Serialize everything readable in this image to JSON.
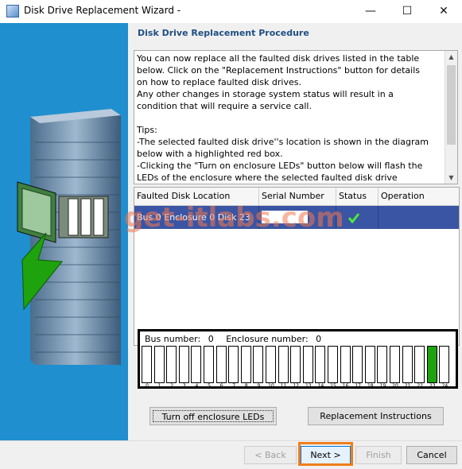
{
  "window": {
    "title": "Disk Drive Replacement Wizard -",
    "minimize_glyph": "—",
    "maximize_glyph": "☐",
    "close_glyph": "✕"
  },
  "header": {
    "title": "Disk Drive Replacement Procedure"
  },
  "instructions": {
    "lines": [
      "You can now replace all the faulted disk drives listed in the table",
      "below. Click on the \"Replacement Instructions\" button for details",
      "on how to replace faulted disk drives.",
      "Any other changes in storage system status will result in a",
      "condition that will require a service call.",
      "",
      "Tips:",
      "-The selected faulted disk drive''s location is shown in the diagram",
      "below with a highlighted red box.",
      "-Clicking the \"Turn on enclosure LEDs\" button below will flash the",
      "LEDs of the enclosure where the selected faulted disk drive"
    ]
  },
  "table": {
    "columns": [
      "Faulted Disk Location",
      "Serial Number",
      "Status",
      "Operation"
    ],
    "rows": [
      {
        "location": "Bus 0 Enclosure 0 Disk 23",
        "serial": "",
        "status_icon": "checkmark-icon",
        "operation": ""
      }
    ]
  },
  "diagram": {
    "bus_label": "Bus number:",
    "bus_number": "0",
    "enclosure_label": "Enclosure number:",
    "enclosure_number": "0",
    "slot_count": 25,
    "highlighted_slot": 23,
    "highlight_color": "#1ea20d"
  },
  "buttons": {
    "turn_off_leds": "Turn off enclosure LEDs",
    "replacement_instructions": "Replacement Instructions",
    "back": "< Back",
    "next": "Next >",
    "finish": "Finish",
    "cancel": "Cancel"
  },
  "watermark": "get-itlabs.com",
  "colors": {
    "side_panel": "#1f8fcf",
    "selection": "#3a55a3",
    "title_text": "#1f4f82",
    "highlight": "#f07d1a"
  }
}
